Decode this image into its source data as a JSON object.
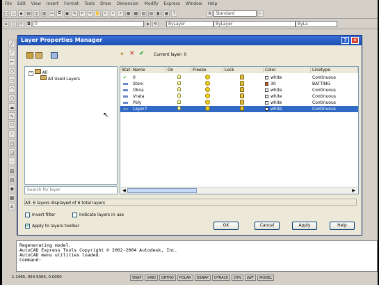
{
  "menu": [
    "File",
    "Edit",
    "View",
    "Insert",
    "Format",
    "Tools",
    "Draw",
    "Dimension",
    "Modify",
    "Express",
    "Window",
    "Help"
  ],
  "toolbar": {
    "style_combo": "Standard",
    "layer_combo": "0",
    "color_combo": "ByLayer",
    "linetype_combo": "ByLayer",
    "lineweight_combo": "ByLa"
  },
  "dialog": {
    "title": "Layer Properties Manager",
    "current_layer": "Current layer: 0",
    "tree": {
      "root": "All",
      "child": "All Used Layers"
    },
    "search_placeholder": "Search for layer",
    "status_text": "All: 6 layers displayed of 6 total layers",
    "invert_filter": "Invert filter",
    "indicate_layers": "Indicate layers in use",
    "apply_toolbar": "Apply to layers toolbar",
    "buttons": {
      "ok": "OK",
      "cancel": "Cancel",
      "apply": "Apply",
      "help": "Help"
    },
    "columns": [
      "Stat",
      "Name",
      "On",
      "Freeze",
      "Lock",
      "Color",
      "Linetype"
    ],
    "rows": [
      {
        "stat": "current",
        "name": "0",
        "color": "white",
        "color_hex": "#ffffff",
        "linetype": "Continuous"
      },
      {
        "stat": "",
        "name": "Steni",
        "color": "30",
        "color_hex": "#e06010",
        "linetype": "BATTING"
      },
      {
        "stat": "",
        "name": "Okna",
        "color": "white",
        "color_hex": "#ffffff",
        "linetype": "Continuous"
      },
      {
        "stat": "",
        "name": "Vrata",
        "color": "white",
        "color_hex": "#ffffff",
        "linetype": "Continuous"
      },
      {
        "stat": "",
        "name": "Poly",
        "color": "white",
        "color_hex": "#ffffff",
        "linetype": "Continuous"
      },
      {
        "stat": "",
        "name": "Layer7",
        "color": "white",
        "color_hex": "#ffffff",
        "linetype": "Continuous",
        "selected": true
      }
    ]
  },
  "command_lines": [
    "Regenerating model.",
    "AutoCAD Express Tools Copyright © 2002-2004 Autodesk, Inc.",
    "AutoCAD menu utilities loaded.",
    "Command:"
  ],
  "status": {
    "coords": "1.1465, 954.9364, 0.0000",
    "toggles": [
      "SNAP",
      "GRID",
      "ORTHO",
      "POLAR",
      "OSNAP",
      "OTRACK",
      "DYN",
      "LWT",
      "MODEL"
    ]
  },
  "colors": {
    "titlebar": "#1a4fb0",
    "selection": "#316ac5"
  }
}
